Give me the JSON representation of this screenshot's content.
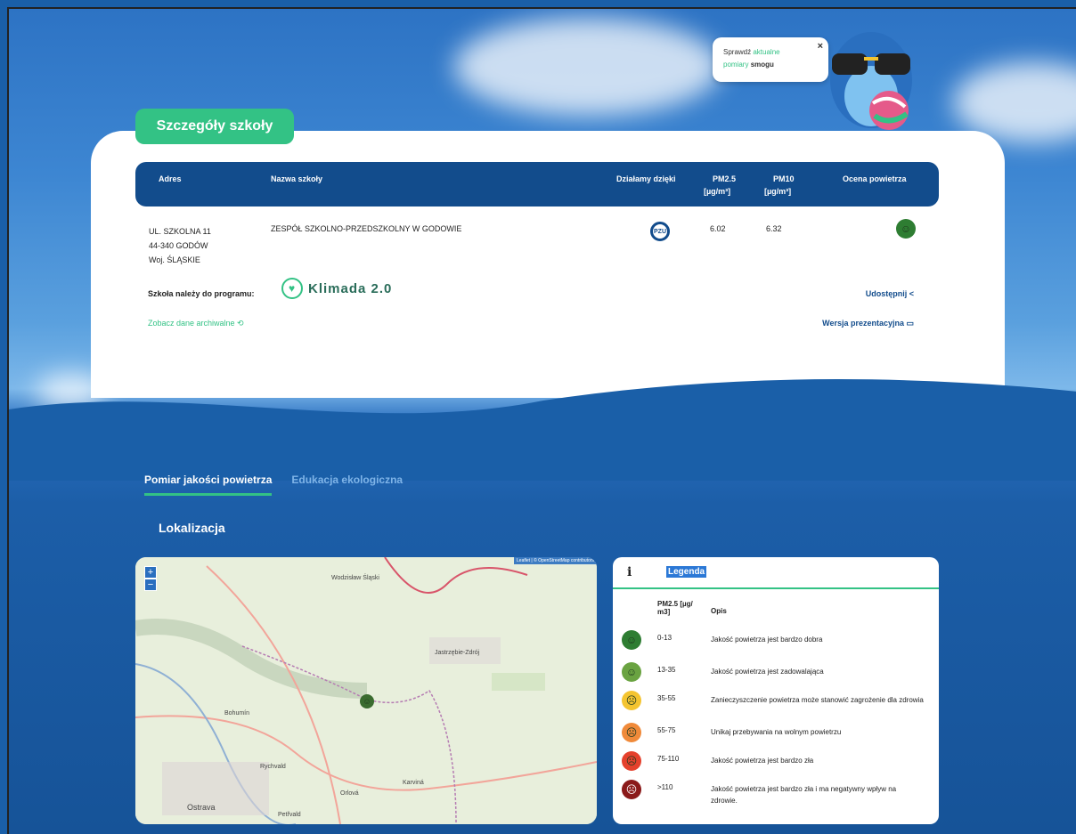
{
  "bubble": {
    "line1_a": "Sprawdź",
    "line1_b": "aktualne",
    "line2_a": "pomiary",
    "line2_b": "smogu",
    "close": "×"
  },
  "page": {
    "title": "Szczegóły szkoły"
  },
  "table": {
    "headers": {
      "address": "Adres",
      "name": "Nazwa szkoły",
      "thanks": "Działamy dzięki",
      "pm25": "PM2.5",
      "pm25_unit": "[µg/m³]",
      "pm10": "PM10",
      "pm10_unit": "[µg/m³]",
      "rating": "Ocena powietrza"
    },
    "row": {
      "street": "UL. SZKOLNA 11",
      "city": "44-340 GODÓW",
      "region": "Woj. ŚLĄSKIE",
      "school": "ZESPÓŁ SZKOLNO-PRZEDSZKOLNY W GODOWIE",
      "sponsor": "PZU",
      "pm25": "6.02",
      "pm10": "6.32"
    }
  },
  "program": {
    "label": "Szkoła należy do programu:",
    "name": "Klimada 2.0"
  },
  "links": {
    "archive": "Zobacz dane archiwalne ⟲",
    "share": "Udostępnij <",
    "presentation": "Wersja prezentacyjna ▭"
  },
  "tabs": [
    {
      "label": "Pomiar jakości powietrza"
    },
    {
      "label": "Edukacja ekologiczna"
    }
  ],
  "section": {
    "title": "Lokalizacja"
  },
  "map": {
    "zoom_in": "+",
    "zoom_out": "−",
    "attribution": "Leaflet | © OpenStreetMap contributors",
    "labels": [
      "Wodzisław Śląski",
      "Jastrzębie-Zdrój",
      "Bohumín",
      "Ostrava",
      "Karviná",
      "Rychvald",
      "Petřvald",
      "Orlová"
    ]
  },
  "legend": {
    "info": "i",
    "title": "Legenda",
    "col_range": "PM2.5 [µg/ m3]",
    "col_desc": "Opis",
    "rows": [
      {
        "range": "0-13",
        "desc": "Jakość powietrza jest bardzo dobra",
        "color": "#2e7d32",
        "icon": "smile-icon"
      },
      {
        "range": "13-35",
        "desc": "Jakość powietrza jest zadowalająca",
        "color": "#6aa341",
        "icon": "neutral-icon"
      },
      {
        "range": "35-55",
        "desc": "Zanieczyszczenie powietrza może stanowić zagrożenie dla zdrowia",
        "color": "#f4c430",
        "icon": "worried-icon"
      },
      {
        "range": "55-75",
        "desc": "Unikaj przebywania na wolnym powietrzu",
        "color": "#f08a3a",
        "icon": "sad-icon"
      },
      {
        "range": "75-110",
        "desc": "Jakość powietrza jest bardzo zła",
        "color": "#e5412d",
        "icon": "angry-icon"
      },
      {
        "range": ">110",
        "desc": "Jakość powietrza jest bardzo zła i ma negatywny wpływ na zdrowie.",
        "color": "#8b1a1a",
        "icon": "shocked-icon"
      }
    ]
  },
  "colors": {
    "accent": "#33c285",
    "navy": "#124c8c"
  }
}
